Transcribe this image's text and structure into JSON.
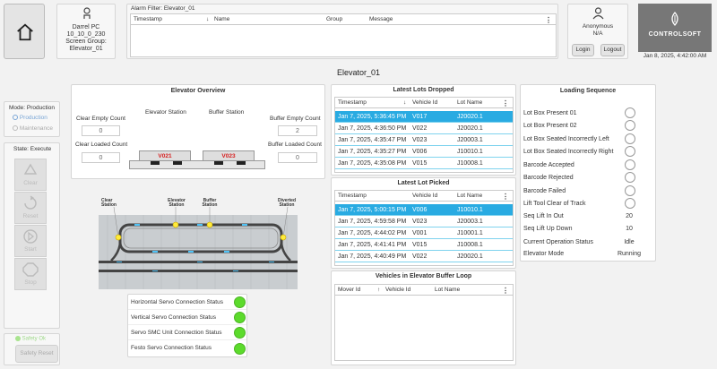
{
  "header": {
    "user": {
      "name": "Darrel PC",
      "ip": "10_10_0_230",
      "screen_group_label": "Screen Group:",
      "screen_group": "Elevator_01"
    },
    "alarm": {
      "title": "Alarm Filter: Elevator_01",
      "columns": [
        "Timestamp",
        "Name",
        "Group",
        "Message"
      ]
    },
    "account": {
      "name": "Anonymous",
      "role": "N/A",
      "login": "Login",
      "logout": "Logout"
    },
    "brand": {
      "logo_text": "CONTROLSOFT",
      "datetime": "Jan 8, 2025, 4:42:00 AM"
    }
  },
  "page_title": "Elevator_01",
  "left": {
    "mode_label": "Mode: Production",
    "mode_options": [
      "Production",
      "Maintenance"
    ],
    "state_label": "State: Execute",
    "buttons": [
      "Clear",
      "Reset",
      "Start",
      "Stop"
    ],
    "safety_ok": "Safety Ok",
    "safety_reset": "Safety Reset"
  },
  "overview": {
    "title": "Elevator Overview",
    "elevator_station": "Elevator Station",
    "buffer_station": "Buffer Station",
    "clear_empty_label": "Clear Empty Count",
    "clear_empty_value": "0",
    "clear_loaded_label": "Clear Loaded Count",
    "clear_loaded_value": "0",
    "buffer_empty_label": "Buffer Empty Count",
    "buffer_empty_value": "2",
    "buffer_loaded_label": "Buffer Loaded Count",
    "buffer_loaded_value": "0",
    "carrier_left": "V021",
    "carrier_right": "V023"
  },
  "track": {
    "labels": [
      "Clear Station",
      "Elevator Station",
      "Buffer Station",
      "Diverted Station"
    ]
  },
  "servo": {
    "items": [
      "Horizontal Servo Connection Status",
      "Vertical Servo Connection Status",
      "Servo SMC Unit Connection Status",
      "Festo Servo Connection Status"
    ],
    "status_color": "#5cdb2c"
  },
  "lots_dropped": {
    "title": "Latest Lots Dropped",
    "columns": [
      "Timestamp",
      "Vehicle Id",
      "Lot Name"
    ],
    "rows": [
      [
        "Jan 7, 2025, 5:36:45 PM",
        "V017",
        "J20020.1"
      ],
      [
        "Jan 7, 2025, 4:36:50 PM",
        "V022",
        "J20020.1"
      ],
      [
        "Jan 7, 2025, 4:35:47 PM",
        "V023",
        "J20003.1"
      ],
      [
        "Jan 7, 2025, 4:35:27 PM",
        "V006",
        "J10010.1"
      ],
      [
        "Jan 7, 2025, 4:35:08 PM",
        "V015",
        "J10008.1"
      ]
    ]
  },
  "lot_picked": {
    "title": "Latest Lot Picked",
    "columns": [
      "Timestamp",
      "Vehicle Id",
      "Lot Name"
    ],
    "rows": [
      [
        "Jan 7, 2025, 5:00:15 PM",
        "V006",
        "J10010.1"
      ],
      [
        "Jan 7, 2025, 4:59:58 PM",
        "V023",
        "J20003.1"
      ],
      [
        "Jan 7, 2025, 4:44:02 PM",
        "V001",
        "J10001.1"
      ],
      [
        "Jan 7, 2025, 4:41:41 PM",
        "V015",
        "J10008.1"
      ],
      [
        "Jan 7, 2025, 4:40:49 PM",
        "V022",
        "J20020.1"
      ]
    ]
  },
  "buffer_loop": {
    "title": "Vehicles in Elevator Buffer Loop",
    "columns": [
      "Mover Id",
      "Vehicle Id",
      "Lot Name"
    ]
  },
  "loading": {
    "title": "Loading Sequence",
    "checks": [
      "Lot Box Present 01",
      "Lot Box Present 02",
      "Lot Box Seated Incorrectly Left",
      "Lot Box Seated Incorrectly Right",
      "Barcode Accepted",
      "Barcode Rejected",
      "Barcode Failed",
      "Lift Tool Clear of Track"
    ],
    "values": [
      {
        "label": "Seq Lift In Out",
        "value": "20"
      },
      {
        "label": "Seq Lift Up Down",
        "value": "10"
      },
      {
        "label": "Current Operation Status",
        "value": "Idle"
      },
      {
        "label": "Elevator Mode",
        "value": "Running"
      }
    ]
  },
  "colors": {
    "selected_row": "#29abe2",
    "carrier_red": "#d62020",
    "brand_bg": "#777777"
  }
}
